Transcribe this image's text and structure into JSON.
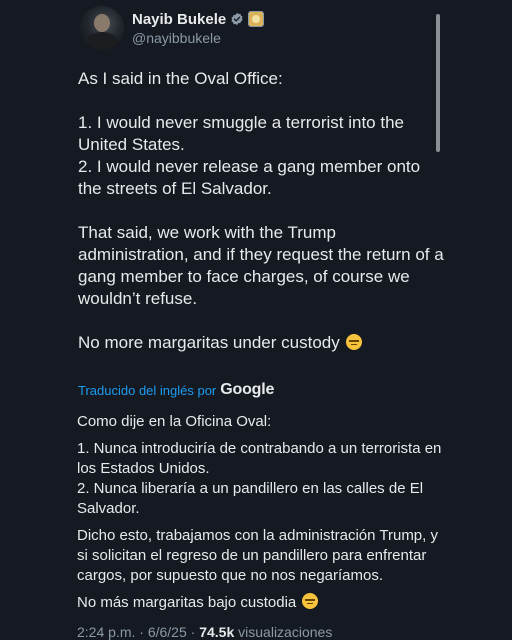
{
  "author": {
    "display_name": "Nayib Bukele",
    "handle": "@nayibbukele"
  },
  "icons": {
    "verified": "verified-badge-icon",
    "affiliate": "government-affiliate-badge-icon",
    "emoji": "pensive-face-emoji"
  },
  "colors": {
    "background": "#151a22",
    "accent": "#1d9bf0",
    "verified_badge": "#8b98a5"
  },
  "tweet": {
    "paragraphs": [
      "As I said in the Oval Office:",
      "1. I would never smuggle a terrorist into the United States.",
      "2. I would never release a gang member onto the streets of El Salvador.",
      "That said, we work with the Trump administration, and if they request the return of a gang member to face charges, of course we wouldn’t refuse.",
      "No more margaritas under custody"
    ]
  },
  "translation": {
    "label": "Traducido del inglés por",
    "provider": "Google",
    "paragraphs": [
      "Como dije en la Oficina Oval:",
      "1. Nunca introduciría de contrabando a un terrorista en los Estados Unidos.",
      "2.  Nunca liberaría a un pandillero en las calles de El Salvador.",
      "Dicho esto, trabajamos con la administración Trump, y si solicitan el regreso de un pandillero para enfrentar cargos, por supuesto que no nos negaríamos.",
      "No más margaritas bajo custodia"
    ]
  },
  "meta": {
    "time": "2:24 p.m.",
    "separator": "·",
    "date": "6/6/25",
    "views_count": "74.5k",
    "views_label": "visualizaciones"
  }
}
